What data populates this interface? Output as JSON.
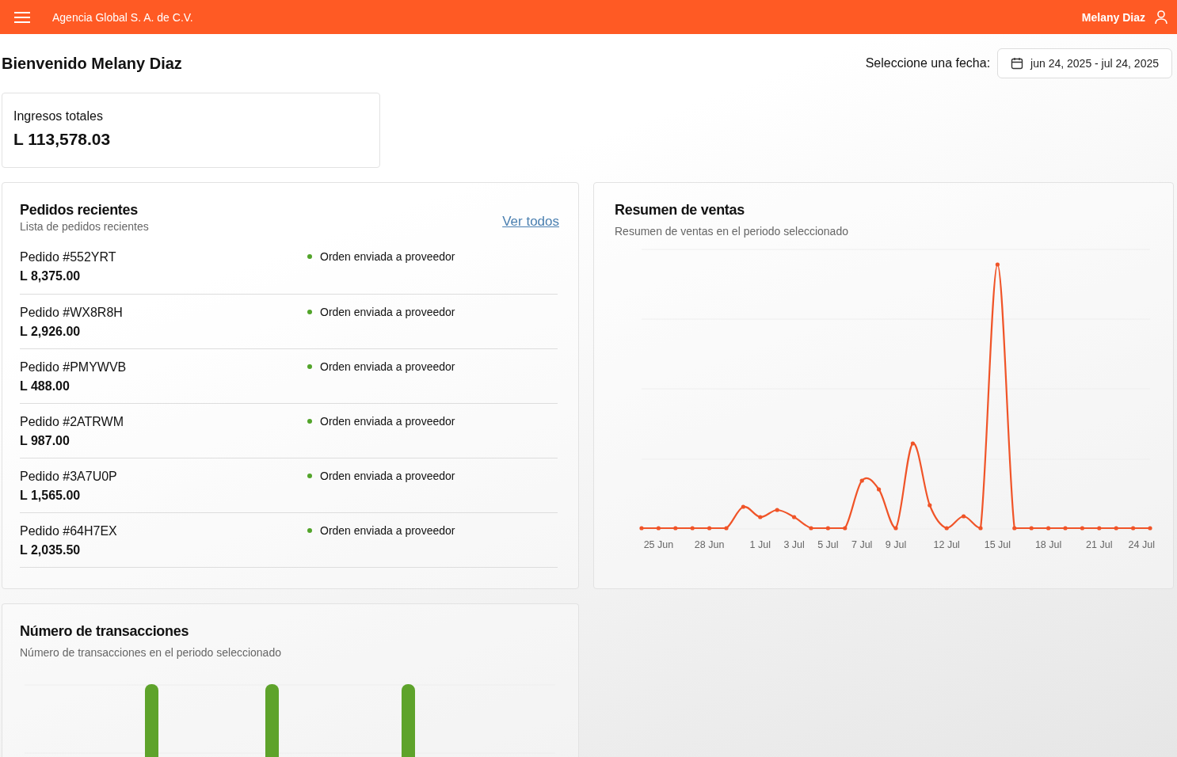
{
  "header": {
    "company": "Agencia Global S. A. de C.V.",
    "user": "Melany Diaz"
  },
  "welcome": "Bienvenido Melany Diaz",
  "date_filter": {
    "label": "Seleccione una fecha:",
    "value": "jun 24, 2025 - jul 24, 2025"
  },
  "total_income": {
    "label": "Ingresos totales",
    "value": "L 113,578.03"
  },
  "recent_orders": {
    "title": "Pedidos recientes",
    "subtitle": "Lista de pedidos recientes",
    "link": "Ver todos",
    "orders": [
      {
        "id": "Pedido #552YRT",
        "amount": "L 8,375.00",
        "status": "Orden enviada a proveedor",
        "color": "#52a42a"
      },
      {
        "id": "Pedido #WX8R8H",
        "amount": "L 2,926.00",
        "status": "Orden enviada a proveedor",
        "color": "#52a42a"
      },
      {
        "id": "Pedido #PMYWVB",
        "amount": "L 488.00",
        "status": "Orden enviada a proveedor",
        "color": "#52a42a"
      },
      {
        "id": "Pedido #2ATRWM",
        "amount": "L 987.00",
        "status": "Orden enviada a proveedor",
        "color": "#52a42a"
      },
      {
        "id": "Pedido #3A7U0P",
        "amount": "L 1,565.00",
        "status": "Orden enviada a proveedor",
        "color": "#52a42a"
      },
      {
        "id": "Pedido #64H7EX",
        "amount": "L 2,035.50",
        "status": "Orden enviada a proveedor",
        "color": "#52a42a"
      }
    ]
  },
  "sales_summary": {
    "title": "Resumen de ventas",
    "subtitle": "Resumen de ventas en el periodo seleccionado",
    "x_labels": [
      "25 Jun",
      "28 Jun",
      "1 Jul",
      "3 Jul",
      "5 Jul",
      "7 Jul",
      "9 Jul",
      "12 Jul",
      "15 Jul",
      "18 Jul",
      "21 Jul",
      "24 Jul"
    ]
  },
  "transactions": {
    "title": "Número de transacciones",
    "subtitle": "Número de transacciones en el periodo seleccionado"
  }
}
